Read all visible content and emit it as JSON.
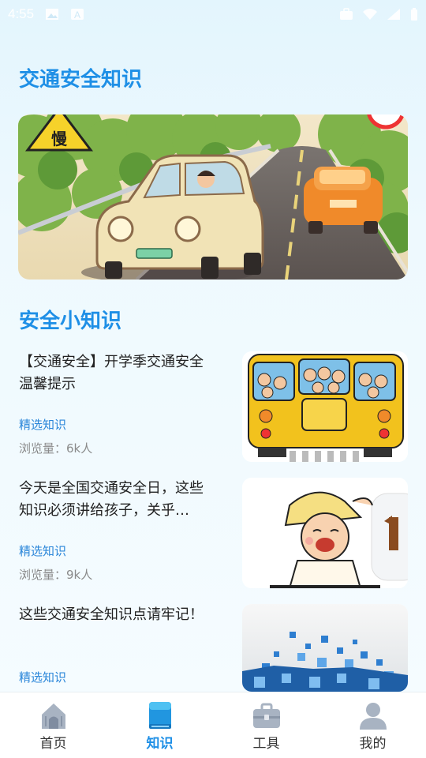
{
  "status_bar": {
    "time": "4:55"
  },
  "header": {
    "title": "交通安全知识"
  },
  "banner": {
    "sign_text": "慢"
  },
  "section": {
    "title": "安全小知识"
  },
  "articles": [
    {
      "title": "【交通安全】开学季交通安全温馨提示",
      "tag": "精选知识",
      "views_label": "浏览量：",
      "views": "6k人"
    },
    {
      "title": "今天是全国交通安全日，这些知识必须讲给孩子，关乎…",
      "tag": "精选知识",
      "views_label": "浏览量：",
      "views": "9k人"
    },
    {
      "title": "这些交通安全知识点请牢记！",
      "tag": "精选知识"
    }
  ],
  "tabbar": {
    "items": [
      {
        "label": "首页",
        "icon": "home-icon"
      },
      {
        "label": "知识",
        "icon": "book-icon"
      },
      {
        "label": "工具",
        "icon": "toolbox-icon"
      },
      {
        "label": "我的",
        "icon": "user-icon"
      }
    ],
    "active_index": 1
  },
  "colors": {
    "accent": "#1e8fe6",
    "tag": "#2a86d9",
    "muted": "#8a8a8a"
  }
}
